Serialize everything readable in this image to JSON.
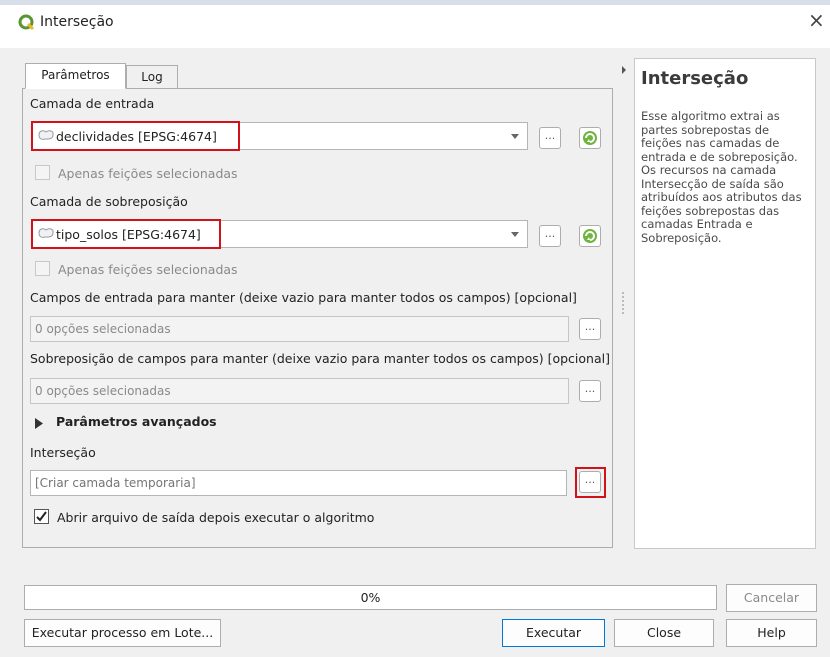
{
  "window": {
    "title": "Interseção",
    "close_glyph": "×"
  },
  "tabs": [
    {
      "label": "Parâmetros",
      "active": true
    },
    {
      "label": "Log",
      "active": false
    }
  ],
  "params": {
    "input_layer_label": "Camada de entrada",
    "input_layer_value": "declividades [EPSG:4674]",
    "input_selected_only": "Apenas feições selecionadas",
    "overlay_layer_label": "Camada de sobreposição",
    "overlay_layer_value": "tipo_solos [EPSG:4674]",
    "overlay_selected_only": "Apenas feições selecionadas",
    "input_fields_label": "Campos de entrada para manter (deixe vazio para manter todos os campos) [opcional]",
    "input_fields_value": "0 opções selecionadas",
    "overlay_fields_label": "Sobreposição de campos para manter (deixe vazio para manter todos os campos) [opcional]",
    "overlay_fields_value": "0 opções selecionadas",
    "advanced_label": "Parâmetros avançados",
    "output_label": "Interseção",
    "output_placeholder": "[Criar camada temporaria]",
    "open_output_label": "Abrir arquivo de saída depois executar o algoritmo",
    "open_output_checked": true,
    "ellipsis": "..."
  },
  "help": {
    "title": "Interseção",
    "body": "Esse algoritmo extrai as partes sobrepostas de feições nas camadas de entrada e de sobreposição. Os recursos na camada Intersecção de saída são atribuídos aos atributos das feições sobrepostas das camadas Entrada e Sobreposição."
  },
  "footer": {
    "progress_text": "0%",
    "progress_value": 0,
    "cancel_label": "Cancelar",
    "batch_label": "Executar processo em Lote...",
    "run_label": "Executar",
    "close_label": "Close",
    "help_label": "Help"
  },
  "colors": {
    "highlight": "#d0121b",
    "qgis_green": "#589632",
    "qgis_yellow": "#f0b82d"
  },
  "icons": [
    "qgis-logo-icon",
    "polygon-layer-icon",
    "iterate-icon",
    "expand-triangle-icon",
    "checkmark-icon",
    "close-icon",
    "combo-arrow-icon"
  ]
}
